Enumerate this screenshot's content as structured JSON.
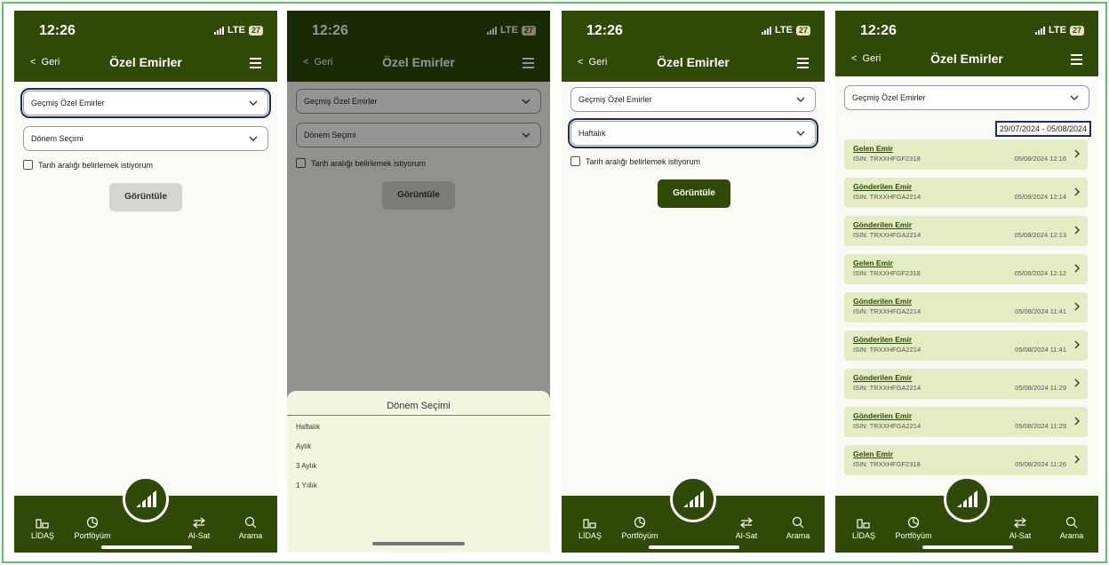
{
  "status": {
    "time": "12:26",
    "network": "LTE",
    "battery": "27"
  },
  "nav": {
    "back_label": "Geri",
    "title": "Özel Emirler"
  },
  "form": {
    "order_type_value": "Geçmiş Özel Emirler",
    "period_placeholder": "Dönem Seçimi",
    "period_selected": "Haftalık",
    "date_range_checkbox_label": "Tarih aralığı belirlemek istiyorum",
    "view_button_label": "Görüntüle"
  },
  "period_sheet": {
    "title": "Dönem Seçimi",
    "options": [
      "Haftalık",
      "Aylık",
      "3 Aylık",
      "1 Yıllık"
    ]
  },
  "tabbar": {
    "lidas": "LİDAŞ",
    "portfolio": "Portföyüm",
    "trade": "Al-Sat",
    "search": "Arama"
  },
  "results": {
    "date_range": "29/07/2024 - 05/08/2024",
    "orders": [
      {
        "title": "Gelen Emir",
        "isin": "ISIN: TRXXHFGF2318",
        "datetime": "05/08/2024 12:16"
      },
      {
        "title": "Gönderilen Emir",
        "isin": "ISIN: TRXXHFGA2214",
        "datetime": "05/08/2024 12:14"
      },
      {
        "title": "Gönderilen Emir",
        "isin": "ISIN: TRXXHFGA2214",
        "datetime": "05/08/2024 12:13"
      },
      {
        "title": "Gelen Emir",
        "isin": "ISIN: TRXXHFGF2318",
        "datetime": "05/08/2024 12:12"
      },
      {
        "title": "Gönderilen Emir",
        "isin": "ISIN: TRXXHFGA2214",
        "datetime": "05/08/2024 11:41"
      },
      {
        "title": "Gönderilen Emir",
        "isin": "ISIN: TRXXHFGA2214",
        "datetime": "05/08/2024 11:41"
      },
      {
        "title": "Gönderilen Emir",
        "isin": "ISIN: TRXXHFGA2214",
        "datetime": "05/08/2024 11:29"
      },
      {
        "title": "Gönderilen Emir",
        "isin": "ISIN: TRXXHFGA2214",
        "datetime": "05/08/2024 11:29"
      },
      {
        "title": "Gelen Emir",
        "isin": "ISIN: TRXXHFGF2318",
        "datetime": "05/08/2024 11:26"
      }
    ]
  },
  "colors": {
    "brand_green": "#2e4a06",
    "card_green": "#e4ecc4",
    "highlight_navy": "#1d2d60",
    "frame_green": "#5cc26a"
  }
}
